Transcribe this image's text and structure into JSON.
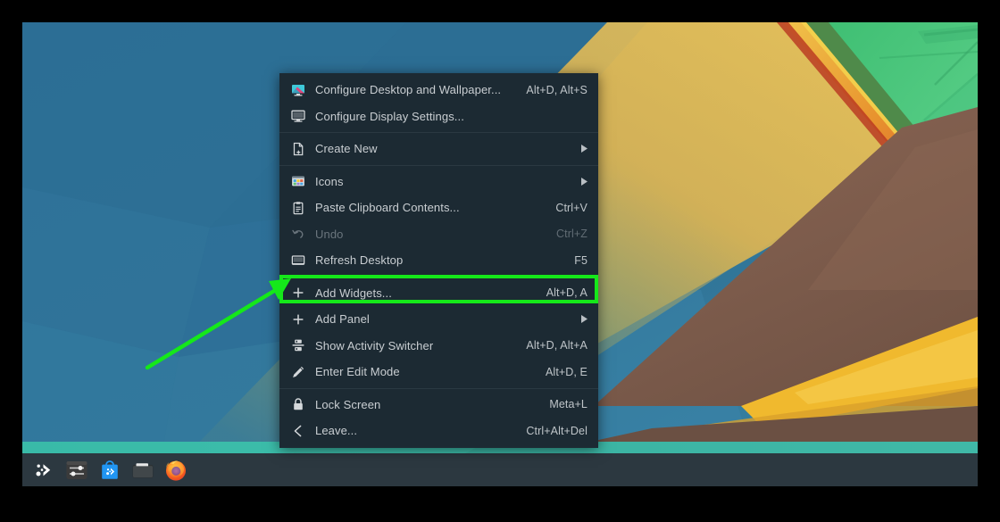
{
  "desktop": {
    "environment": "KDE Plasma Desktop",
    "wallpaper_name": "abstract-polygonal-landscape"
  },
  "colors": {
    "menu_background": "#1c2a33",
    "menu_text": "#c9ced2",
    "menu_text_disabled": "#6a757d",
    "menu_separator": "#2a3942",
    "panel_background": "#2c3840",
    "annotation_green": "#15e81a",
    "wallpaper_blue": "#2f6f93",
    "wallpaper_green": "#4ecb7a",
    "wallpaper_brown": "#7b5a4a",
    "wallpaper_yellow": "#e0b33c",
    "wallpaper_teal": "#3fb5a5"
  },
  "context_menu": {
    "name": "desktop-context-menu",
    "items": [
      {
        "id": "configure-desktop-and-wallpaper",
        "label": "Configure Desktop and Wallpaper...",
        "shortcut": "Alt+D, Alt+S",
        "icon": "wallpaper-monitor-icon",
        "disabled": false,
        "submenu": false,
        "separator_after": false
      },
      {
        "id": "configure-display-settings",
        "label": "Configure Display Settings...",
        "shortcut": "",
        "icon": "monitor-icon",
        "disabled": false,
        "submenu": false,
        "separator_after": true
      },
      {
        "id": "create-new",
        "label": "Create New",
        "shortcut": "",
        "icon": "new-document-icon",
        "disabled": false,
        "submenu": true,
        "separator_after": true
      },
      {
        "id": "icons",
        "label": "Icons",
        "shortcut": "",
        "icon": "icons-grid-icon",
        "disabled": false,
        "submenu": true,
        "separator_after": false
      },
      {
        "id": "paste-clipboard-contents",
        "label": "Paste Clipboard Contents...",
        "shortcut": "Ctrl+V",
        "icon": "clipboard-icon",
        "disabled": false,
        "submenu": false,
        "separator_after": false
      },
      {
        "id": "undo",
        "label": "Undo",
        "shortcut": "Ctrl+Z",
        "icon": "undo-arrow-icon",
        "disabled": true,
        "submenu": false,
        "separator_after": false
      },
      {
        "id": "refresh-desktop",
        "label": "Refresh Desktop",
        "shortcut": "F5",
        "icon": "refresh-monitor-icon",
        "disabled": false,
        "submenu": false,
        "separator_after": true
      },
      {
        "id": "add-widgets",
        "label": "Add Widgets...",
        "shortcut": "Alt+D, A",
        "icon": "plus-icon",
        "disabled": false,
        "submenu": false,
        "separator_after": false,
        "highlighted": true
      },
      {
        "id": "add-panel",
        "label": "Add Panel",
        "shortcut": "",
        "icon": "plus-icon",
        "disabled": false,
        "submenu": true,
        "separator_after": false
      },
      {
        "id": "show-activity-switcher",
        "label": "Show Activity Switcher",
        "shortcut": "Alt+D, Alt+A",
        "icon": "activity-switcher-icon",
        "disabled": false,
        "submenu": false,
        "separator_after": false
      },
      {
        "id": "enter-edit-mode",
        "label": "Enter Edit Mode",
        "shortcut": "Alt+D, E",
        "icon": "pencil-icon",
        "disabled": false,
        "submenu": false,
        "separator_after": true
      },
      {
        "id": "lock-screen",
        "label": "Lock Screen",
        "shortcut": "Meta+L",
        "icon": "lock-icon",
        "disabled": false,
        "submenu": false,
        "separator_after": false
      },
      {
        "id": "leave",
        "label": "Leave...",
        "shortcut": "Ctrl+Alt+Del",
        "icon": "leave-chevron-icon",
        "disabled": false,
        "submenu": false,
        "separator_after": false
      }
    ]
  },
  "panel": {
    "name": "plasma-panel",
    "launchers": [
      {
        "id": "application-launcher",
        "label": "Application Launcher",
        "icon": "kde-kickoff-icon"
      },
      {
        "id": "system-settings",
        "label": "System Settings",
        "icon": "system-settings-icon"
      },
      {
        "id": "discover",
        "label": "Discover",
        "icon": "discover-bag-icon"
      },
      {
        "id": "file-manager",
        "label": "File Manager",
        "icon": "dolphin-folder-icon"
      },
      {
        "id": "firefox",
        "label": "Firefox",
        "icon": "firefox-icon"
      }
    ]
  },
  "annotation": {
    "name": "instruction-arrow",
    "target": "add-widgets",
    "color": "#15e81a",
    "description": "Green arrow pointing to the Add Widgets menu entry, which is outlined with a green rectangle"
  }
}
